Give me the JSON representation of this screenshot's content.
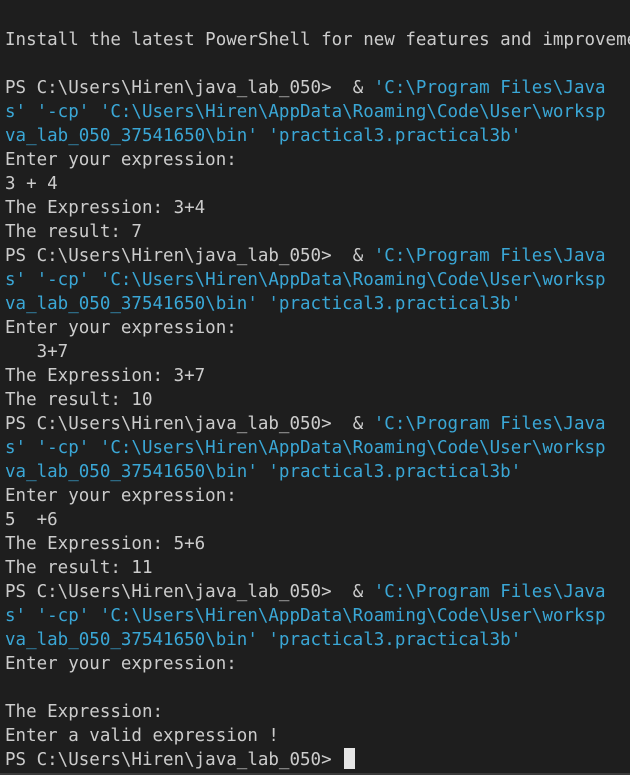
{
  "terminal": {
    "lines": [
      {
        "kind": "text",
        "text": "Install the latest PowerShell for new features and improvements! https://aka.ms/PSWindows"
      },
      {
        "kind": "text",
        "text": ""
      },
      {
        "kind": "cmd",
        "prompt": "PS C:\\Users\\Hiren\\java_lab_050> ",
        "op": " & ",
        "str": "'C:\\Program Files\\Java"
      },
      {
        "kind": "str",
        "text": "s' '-cp' 'C:\\Users\\Hiren\\AppData\\Roaming\\Code\\User\\worksp"
      },
      {
        "kind": "str",
        "text": "va_lab_050_37541650\\bin' 'practical3.practical3b'"
      },
      {
        "kind": "text",
        "text": "Enter your expression:"
      },
      {
        "kind": "text",
        "text": "3 + 4"
      },
      {
        "kind": "text",
        "text": "The Expression: 3+4"
      },
      {
        "kind": "text",
        "text": "The result: 7"
      },
      {
        "kind": "cmd",
        "prompt": "PS C:\\Users\\Hiren\\java_lab_050> ",
        "op": " & ",
        "str": "'C:\\Program Files\\Java"
      },
      {
        "kind": "str",
        "text": "s' '-cp' 'C:\\Users\\Hiren\\AppData\\Roaming\\Code\\User\\worksp"
      },
      {
        "kind": "str",
        "text": "va_lab_050_37541650\\bin' 'practical3.practical3b'"
      },
      {
        "kind": "text",
        "text": "Enter your expression:"
      },
      {
        "kind": "text",
        "text": "   3+7"
      },
      {
        "kind": "text",
        "text": "The Expression: 3+7"
      },
      {
        "kind": "text",
        "text": "The result: 10"
      },
      {
        "kind": "cmd",
        "prompt": "PS C:\\Users\\Hiren\\java_lab_050> ",
        "op": " & ",
        "str": "'C:\\Program Files\\Java"
      },
      {
        "kind": "str",
        "text": "s' '-cp' 'C:\\Users\\Hiren\\AppData\\Roaming\\Code\\User\\worksp"
      },
      {
        "kind": "str",
        "text": "va_lab_050_37541650\\bin' 'practical3.practical3b'"
      },
      {
        "kind": "text",
        "text": "Enter your expression:"
      },
      {
        "kind": "text",
        "text": "5  +6"
      },
      {
        "kind": "text",
        "text": "The Expression: 5+6"
      },
      {
        "kind": "text",
        "text": "The result: 11"
      },
      {
        "kind": "cmd",
        "prompt": "PS C:\\Users\\Hiren\\java_lab_050> ",
        "op": " & ",
        "str": "'C:\\Program Files\\Java"
      },
      {
        "kind": "str",
        "text": "s' '-cp' 'C:\\Users\\Hiren\\AppData\\Roaming\\Code\\User\\worksp"
      },
      {
        "kind": "str",
        "text": "va_lab_050_37541650\\bin' 'practical3.practical3b'"
      },
      {
        "kind": "text",
        "text": "Enter your expression:"
      },
      {
        "kind": "text",
        "text": ""
      },
      {
        "kind": "text",
        "text": "The Expression:"
      },
      {
        "kind": "text",
        "text": "Enter a valid expression !"
      },
      {
        "kind": "input",
        "prompt": "PS C:\\Users\\Hiren\\java_lab_050> "
      }
    ]
  },
  "colors": {
    "background": "#1e1e1e",
    "text": "#cccccc",
    "string": "#3aa7d6",
    "cursor": "#e6e6e6"
  }
}
